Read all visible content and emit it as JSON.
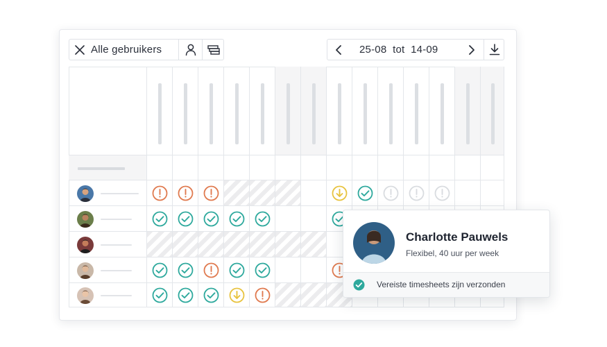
{
  "toolbar": {
    "filter_label": "Alle gebruikers",
    "close_icon": "close-icon",
    "person_icon": "person-icon",
    "group_icon": "group-icon",
    "date_range_label": "25-08  tot  14-09",
    "prev_icon": "chevron-left-icon",
    "next_icon": "chevron-right-icon",
    "download_icon": "download-icon"
  },
  "colors": {
    "ok": "#2ea99d",
    "warning": "#e07a4f",
    "pending": "#e8c33f",
    "empty": "#d9dce0",
    "bar": "#dcdfe3"
  },
  "rows": [
    {
      "user": "user-1",
      "cells": [
        "",
        "warning",
        "warning",
        "warning",
        "hatch",
        "hatch",
        "hatch-shade",
        "",
        "pending",
        "ok",
        "empty",
        "empty",
        "empty",
        "",
        ""
      ]
    },
    {
      "user": "user-2",
      "cells": [
        "",
        "ok",
        "ok",
        "ok",
        "ok",
        "ok",
        "",
        "",
        "ok",
        "",
        "",
        "",
        "",
        "",
        ""
      ]
    },
    {
      "user": "user-3",
      "cells": [
        "",
        "hatch",
        "hatch",
        "hatch",
        "hatch",
        "hatch",
        "hatch",
        "hatch",
        "",
        "",
        "",
        "",
        "",
        "",
        ""
      ]
    },
    {
      "user": "user-4",
      "cells": [
        "",
        "ok",
        "ok",
        "warning",
        "ok",
        "ok",
        "",
        "",
        "warning",
        "",
        "",
        "",
        "",
        "",
        ""
      ]
    },
    {
      "user": "user-5",
      "cells": [
        "",
        "ok",
        "ok",
        "ok",
        "pending",
        "warning",
        "hatch",
        "hatch",
        "hatch",
        "",
        "",
        "",
        "",
        "",
        ""
      ]
    }
  ],
  "popover": {
    "name": "Charlotte Pauwels",
    "contract": "Flexibel, 40 uur per week",
    "status": "Vereiste timesheets zijn verzonden",
    "status_icon": "check-circle-icon"
  }
}
